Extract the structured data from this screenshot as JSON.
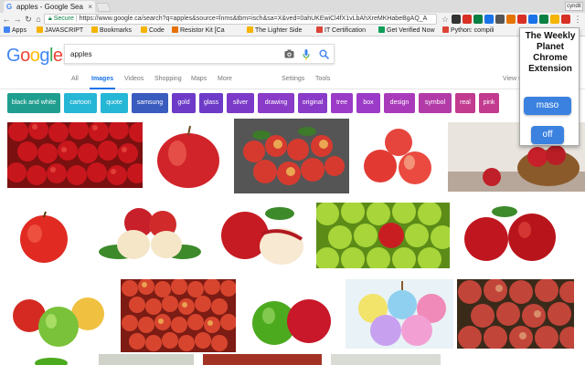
{
  "browser": {
    "tab_title": "apples - Google Sea",
    "profile": "cyndit",
    "secure_label": "Secure",
    "url": "https://www.google.ca/search?q=apples&source=lnms&tbm=isch&sa=X&ved=0ahUKEwiCl4fX1vLbAhXreMKHabeBgAQ_A"
  },
  "bookmarks": [
    {
      "label": "Apps",
      "color": "#4285f4"
    },
    {
      "label": "JAVASCRIPT",
      "color": "#f4b400"
    },
    {
      "label": "Bookmarks",
      "color": "#f4b400"
    },
    {
      "label": "Code",
      "color": "#f4b400"
    },
    {
      "label": "Resistor Kit [Ca",
      "color": "#e8710a"
    },
    {
      "label": "The Lighter Side",
      "color": "#f4b400"
    },
    {
      "label": "IT Certification",
      "color": "#db4437"
    },
    {
      "label": "Get Verified Now",
      "color": "#0f9d58"
    },
    {
      "label": "Python: compili",
      "color": "#db4437"
    }
  ],
  "search": {
    "logo": "Google",
    "query": "apples",
    "camera_icon": "camera-icon",
    "mic_icon": "mic-icon",
    "search_icon": "search-icon"
  },
  "nav_tabs": {
    "all": "All",
    "images": "Images",
    "videos": "Videos",
    "shopping": "Shopping",
    "maps": "Maps",
    "more": "More",
    "settings": "Settings",
    "tools": "Tools",
    "view_saved": "View sa"
  },
  "chips": [
    {
      "label": "black and white",
      "color": "#1f9e8f"
    },
    {
      "label": "cartoon",
      "color": "#26b6d6"
    },
    {
      "label": "quote",
      "color": "#26b6d6"
    },
    {
      "label": "samsung",
      "color": "#3a5cbf"
    },
    {
      "label": "gold",
      "color": "#6d3bc8"
    },
    {
      "label": "glass",
      "color": "#6d3bc8"
    },
    {
      "label": "silver",
      "color": "#7b3bc8"
    },
    {
      "label": "drawing",
      "color": "#8a3bc8"
    },
    {
      "label": "original",
      "color": "#8a3bc8"
    },
    {
      "label": "tree",
      "color": "#9b3bc8"
    },
    {
      "label": "box",
      "color": "#9b3bc8"
    },
    {
      "label": "design",
      "color": "#a93bbb"
    },
    {
      "label": "symbol",
      "color": "#b33ba8"
    },
    {
      "label": "real",
      "color": "#c23b8f"
    },
    {
      "label": "pink",
      "color": "#c23b8f"
    }
  ],
  "popup": {
    "title": "The Weekly Planet Chrome Extension",
    "maso_label": "maso",
    "off_label": "off"
  }
}
